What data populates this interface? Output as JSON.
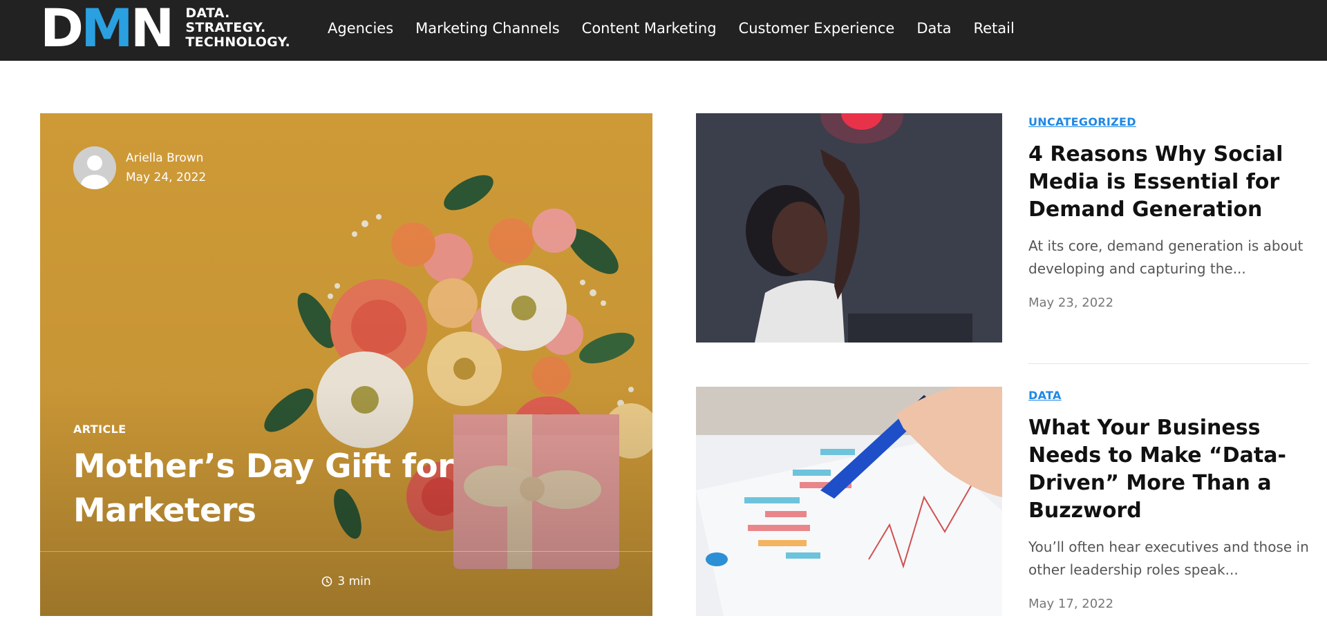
{
  "brand": {
    "logo_letters": [
      "D",
      "M",
      "N"
    ],
    "tagline_lines": [
      "DATA.",
      "STRATEGY.",
      "TECHNOLOGY."
    ],
    "accent_color": "#2aa0e0"
  },
  "nav": {
    "items": [
      {
        "label": "Agencies"
      },
      {
        "label": "Marketing Channels"
      },
      {
        "label": "Content Marketing"
      },
      {
        "label": "Customer Experience"
      },
      {
        "label": "Data"
      },
      {
        "label": "Retail"
      }
    ]
  },
  "featured": {
    "author_name": "Ariella Brown",
    "date": "May 24, 2022",
    "category": "ARTICLE",
    "title": "Mother’s Day Gift for Marketers",
    "read_time": "3 min",
    "icon": "clock-icon"
  },
  "articles": [
    {
      "category": "UNCATEGORIZED",
      "title": "4 Reasons Why Social Media is Essential for Demand Generation",
      "excerpt": "At its core, demand generation is about developing and capturing the...",
      "date": "May 23, 2022"
    },
    {
      "category": "DATA",
      "title": "What Your Business Needs to Make “Data-Driven” More Than a Buzzword",
      "excerpt": "You’ll often hear executives and those in other leadership roles speak...",
      "date": "May 17, 2022"
    }
  ],
  "colors": {
    "header_bg": "#222222",
    "category_blue": "#1e88e5",
    "hero_bg": "#d9a23a"
  }
}
